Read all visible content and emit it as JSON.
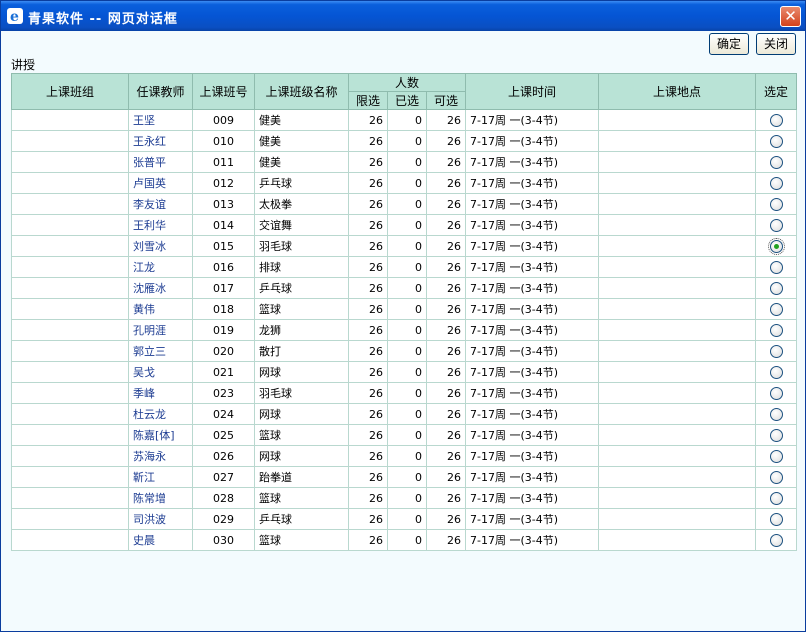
{
  "window": {
    "title": "青果软件 -- 网页对话框",
    "close_glyph": "✕"
  },
  "toolbar": {
    "ok_label": "确定",
    "close_label": "关闭"
  },
  "section": {
    "label": "讲授"
  },
  "table": {
    "headers": {
      "group": "上课班组",
      "teacher": "任课教师",
      "class_no": "上课班号",
      "class_name": "上课班级名称",
      "count": "人数",
      "limit": "限选",
      "selected": "已选",
      "available": "可选",
      "time": "上课时间",
      "place": "上课地点",
      "choose": "选定"
    },
    "rows": [
      {
        "group": "",
        "teacher": "王坚",
        "class_no": "009",
        "class_name": "健美",
        "limit": "26",
        "selected": "0",
        "available": "26",
        "time": "7-17周 一(3-4节)",
        "place": "",
        "checked": false
      },
      {
        "group": "",
        "teacher": "王永红",
        "class_no": "010",
        "class_name": "健美",
        "limit": "26",
        "selected": "0",
        "available": "26",
        "time": "7-17周 一(3-4节)",
        "place": "",
        "checked": false
      },
      {
        "group": "",
        "teacher": "张普平",
        "class_no": "011",
        "class_name": "健美",
        "limit": "26",
        "selected": "0",
        "available": "26",
        "time": "7-17周 一(3-4节)",
        "place": "",
        "checked": false
      },
      {
        "group": "",
        "teacher": "卢国英",
        "class_no": "012",
        "class_name": "乒乓球",
        "limit": "26",
        "selected": "0",
        "available": "26",
        "time": "7-17周 一(3-4节)",
        "place": "",
        "checked": false
      },
      {
        "group": "",
        "teacher": "李友谊",
        "class_no": "013",
        "class_name": "太极拳",
        "limit": "26",
        "selected": "0",
        "available": "26",
        "time": "7-17周 一(3-4节)",
        "place": "",
        "checked": false
      },
      {
        "group": "",
        "teacher": "王利华",
        "class_no": "014",
        "class_name": "交谊舞",
        "limit": "26",
        "selected": "0",
        "available": "26",
        "time": "7-17周 一(3-4节)",
        "place": "",
        "checked": false
      },
      {
        "group": "",
        "teacher": "刘雪冰",
        "class_no": "015",
        "class_name": "羽毛球",
        "limit": "26",
        "selected": "0",
        "available": "26",
        "time": "7-17周 一(3-4节)",
        "place": "",
        "checked": true
      },
      {
        "group": "",
        "teacher": "江龙",
        "class_no": "016",
        "class_name": "排球",
        "limit": "26",
        "selected": "0",
        "available": "26",
        "time": "7-17周 一(3-4节)",
        "place": "",
        "checked": false
      },
      {
        "group": "",
        "teacher": "沈雁冰",
        "class_no": "017",
        "class_name": "乒乓球",
        "limit": "26",
        "selected": "0",
        "available": "26",
        "time": "7-17周 一(3-4节)",
        "place": "",
        "checked": false
      },
      {
        "group": "",
        "teacher": "黄伟",
        "class_no": "018",
        "class_name": "篮球",
        "limit": "26",
        "selected": "0",
        "available": "26",
        "time": "7-17周 一(3-4节)",
        "place": "",
        "checked": false
      },
      {
        "group": "",
        "teacher": "孔明涯",
        "class_no": "019",
        "class_name": "龙狮",
        "limit": "26",
        "selected": "0",
        "available": "26",
        "time": "7-17周 一(3-4节)",
        "place": "",
        "checked": false
      },
      {
        "group": "",
        "teacher": "郭立三",
        "class_no": "020",
        "class_name": "散打",
        "limit": "26",
        "selected": "0",
        "available": "26",
        "time": "7-17周 一(3-4节)",
        "place": "",
        "checked": false
      },
      {
        "group": "",
        "teacher": "吴戈",
        "class_no": "021",
        "class_name": "网球",
        "limit": "26",
        "selected": "0",
        "available": "26",
        "time": "7-17周 一(3-4节)",
        "place": "",
        "checked": false
      },
      {
        "group": "",
        "teacher": "季峰",
        "class_no": "023",
        "class_name": "羽毛球",
        "limit": "26",
        "selected": "0",
        "available": "26",
        "time": "7-17周 一(3-4节)",
        "place": "",
        "checked": false
      },
      {
        "group": "",
        "teacher": "杜云龙",
        "class_no": "024",
        "class_name": "网球",
        "limit": "26",
        "selected": "0",
        "available": "26",
        "time": "7-17周 一(3-4节)",
        "place": "",
        "checked": false
      },
      {
        "group": "",
        "teacher": "陈嘉[体]",
        "class_no": "025",
        "class_name": "篮球",
        "limit": "26",
        "selected": "0",
        "available": "26",
        "time": "7-17周 一(3-4节)",
        "place": "",
        "checked": false
      },
      {
        "group": "",
        "teacher": "苏海永",
        "class_no": "026",
        "class_name": "网球",
        "limit": "26",
        "selected": "0",
        "available": "26",
        "time": "7-17周 一(3-4节)",
        "place": "",
        "checked": false
      },
      {
        "group": "",
        "teacher": "靳江",
        "class_no": "027",
        "class_name": "跆拳道",
        "limit": "26",
        "selected": "0",
        "available": "26",
        "time": "7-17周 一(3-4节)",
        "place": "",
        "checked": false
      },
      {
        "group": "",
        "teacher": "陈常增",
        "class_no": "028",
        "class_name": "篮球",
        "limit": "26",
        "selected": "0",
        "available": "26",
        "time": "7-17周 一(3-4节)",
        "place": "",
        "checked": false
      },
      {
        "group": "",
        "teacher": "司洪波",
        "class_no": "029",
        "class_name": "乒乓球",
        "limit": "26",
        "selected": "0",
        "available": "26",
        "time": "7-17周 一(3-4节)",
        "place": "",
        "checked": false
      },
      {
        "group": "",
        "teacher": "史晨",
        "class_no": "030",
        "class_name": "篮球",
        "limit": "26",
        "selected": "0",
        "available": "26",
        "time": "7-17周 一(3-4节)",
        "place": "",
        "checked": false
      }
    ]
  },
  "icons": {
    "app": "ie-icon",
    "close": "close-icon"
  },
  "colors": {
    "header_bg": "#b9e3d6",
    "teacher_link": "#1d3c92",
    "titlebar": "#0555d4"
  }
}
